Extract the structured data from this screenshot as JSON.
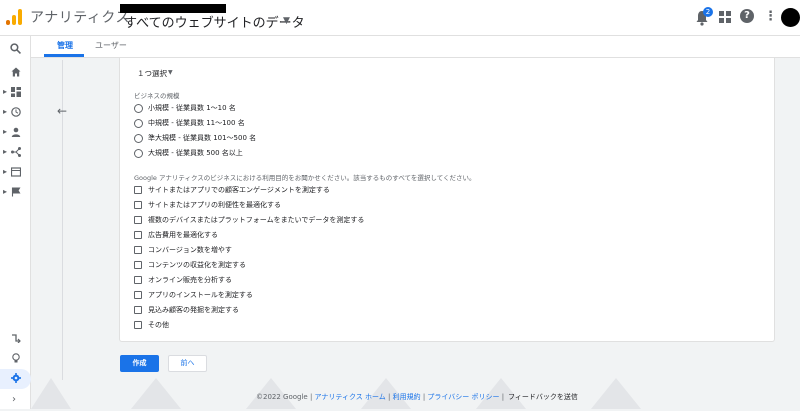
{
  "header": {
    "app_title": "アナリティクス",
    "view_name": "すべてのウェブサイトのデータ",
    "notification_count": "2"
  },
  "tabs": [
    {
      "label": "管理"
    },
    {
      "label": "ユーザー"
    }
  ],
  "form": {
    "select_label": "１つ選択",
    "business_size_label": "ビジネスの規模",
    "sizes": [
      "小規模 - 従業員数 1〜10 名",
      "中規模 - 従業員数 11〜100 名",
      "準大規模 - 従業員数 101〜500 名",
      "大規模 - 従業員数 500 名以上"
    ],
    "purpose_label": "Google アナリティクスのビジネスにおける利用目的をお聞かせください。該当するものすべてを選択してください。",
    "purposes": [
      "サイトまたはアプリでの顧客エンゲージメントを測定する",
      "サイトまたはアプリの利便性を最適化する",
      "複数のデバイスまたはプラットフォームをまたいでデータを測定する",
      "広告費用を最適化する",
      "コンバージョン数を増やす",
      "コンテンツの収益化を測定する",
      "オンライン販売を分析する",
      "アプリのインストールを測定する",
      "見込み顧客の発掘を測定する",
      "その他"
    ]
  },
  "buttons": {
    "create": "作成",
    "previous": "前へ"
  },
  "footer": {
    "copyright": "©2022 Google",
    "home": "アナリティクス ホーム",
    "terms": "利用規約",
    "privacy": "プライバシー ポリシー",
    "feedback": "フィードバックを送信"
  },
  "colors": {
    "accent": "#1a73e8",
    "logo_orange": "#f9ab00"
  }
}
